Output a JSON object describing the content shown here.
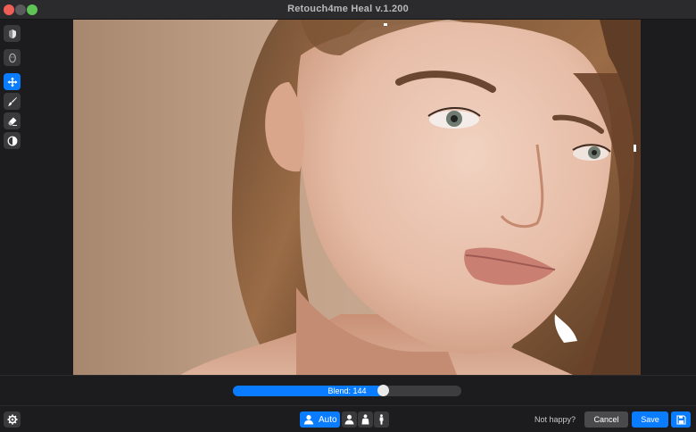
{
  "window": {
    "title": "Retouch4me Heal v.1.200"
  },
  "toolbar": {
    "tools": [
      {
        "icon": "mask-icon",
        "active": false
      },
      {
        "icon": "face-icon",
        "active": false
      },
      {
        "icon": "move-icon",
        "active": true
      },
      {
        "icon": "brush-icon",
        "active": false
      },
      {
        "icon": "eraser-icon",
        "active": false
      },
      {
        "icon": "compare-icon",
        "active": false
      }
    ]
  },
  "blend": {
    "label": "Blend: 144",
    "value": 144,
    "fraction": 0.655
  },
  "bottom": {
    "mode_auto_label": "Auto",
    "not_happy": "Not happy?",
    "cancel_label": "Cancel",
    "save_label": "Save"
  },
  "colors": {
    "accent": "#0a7cff",
    "background": "#1c1c1e"
  }
}
